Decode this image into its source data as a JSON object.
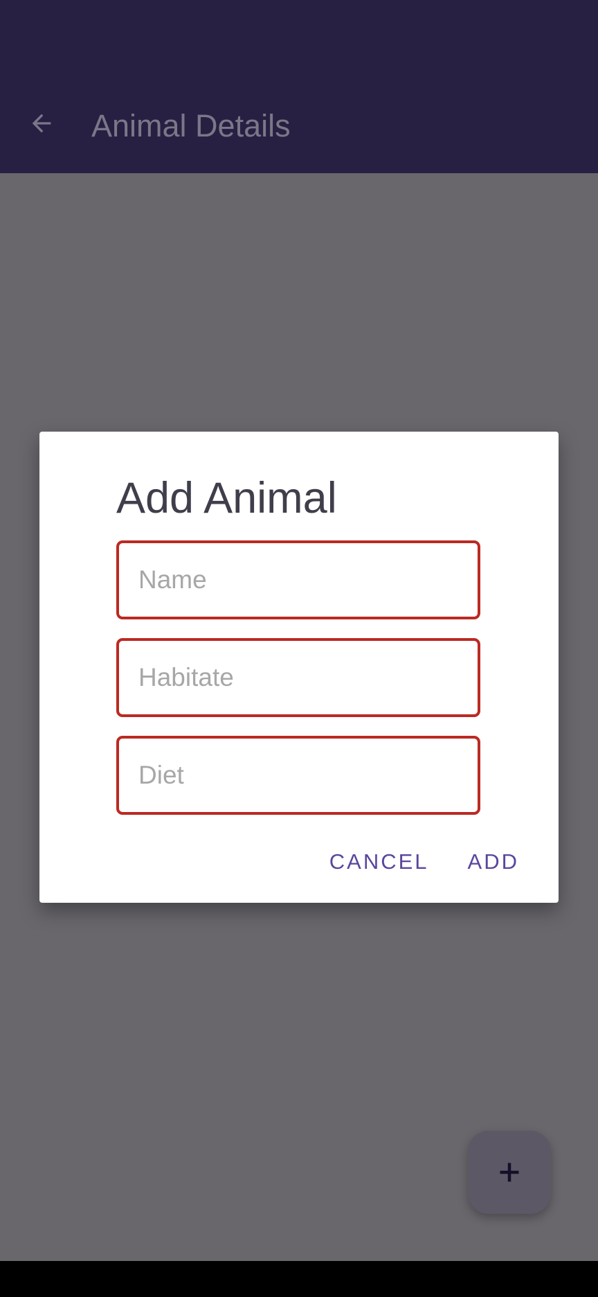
{
  "app_bar": {
    "title": "Animal Details",
    "back_icon": "arrow-back-icon"
  },
  "dialog": {
    "title": "Add Animal",
    "fields": {
      "name": {
        "value": "",
        "placeholder": "Name"
      },
      "habitat": {
        "value": "",
        "placeholder": "Habitate"
      },
      "diet": {
        "value": "",
        "placeholder": "Diet"
      }
    },
    "cancel_label": "CANCEL",
    "add_label": "ADD"
  },
  "fab": {
    "icon": "plus-icon"
  },
  "colors": {
    "app_bar": "#282043",
    "scrim": "#69676c",
    "field_border_error": "#bb2a22",
    "accent_button_text": "#5a469d"
  }
}
